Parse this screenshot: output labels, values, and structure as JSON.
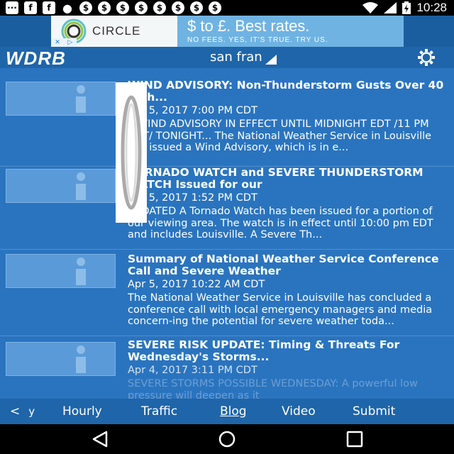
{
  "status_bar": {
    "time": "10:28",
    "icons": [
      "messages-icon",
      "facebook-icon",
      "facebook-icon",
      "location-pin-icon",
      "dollar-icon",
      "dollar-icon",
      "dollar-icon",
      "dollar-icon",
      "dollar-icon",
      "dollar-icon",
      "dollar-icon",
      "dollar-icon",
      "wifi-icon",
      "signal-icon",
      "battery-charging-icon"
    ]
  },
  "ad": {
    "brand": "CIRCLE",
    "headline": "$ to £. Best rates.",
    "subline": "NO FEES. YES, IT'S TRUE. TRY US.",
    "ad_choices_x": "✕",
    "ad_choices_arrow": "▷"
  },
  "app_bar": {
    "logo": "WDRB",
    "location": "san fran",
    "settings_icon": "gear-icon"
  },
  "articles": [
    {
      "title": "WIND ADVISORY: Non-Thunderstorm Gusts Over 40 mph...",
      "date": "Apr 5, 2017 7:00 PM CDT",
      "summary": "...WIND ADVISORY IN EFFECT UNTIL MIDNIGHT EDT /11 PM CDT/ TONIGHT... The National Weather Service in Louisville has issued a Wind Advisory, which is in e..."
    },
    {
      "title": "TORNADO WATCH and SEVERE THUNDERSTORM WATCH Issued for our",
      "date": "Apr 5, 2017 1:52 PM CDT",
      "summary": "UPDATED A Tornado Watch has been issued for a portion of our viewing area. The watch is in effect until 10:00 pm EDT and includes Louisville. A Severe Th..."
    },
    {
      "title": "Summary of National Weather Service Conference Call and Severe Weather",
      "date": "Apr 5, 2017 10:22 AM CDT",
      "summary": "The National Weather Service in Louisville has concluded a conference call with local emergency managers and media concern-ing the potential for severe weather toda..."
    },
    {
      "title": "SEVERE RISK UPDATE: Timing & Threats For Wednesday's Storms...",
      "date": "Apr 4, 2017 3:11 PM CDT",
      "summary": "SEVERE STORMS POSSIBLE WEDNESDAY: A powerful low pressure will deepen as it"
    }
  ],
  "tabs": {
    "back": "<",
    "partial": "y",
    "items": [
      "Hourly",
      "Traffic",
      "Blog",
      "Video",
      "Submit"
    ],
    "active": "Blog"
  },
  "nav": {
    "back": "back-triangle-icon",
    "home": "home-circle-icon",
    "recents": "recents-square-icon"
  },
  "colors": {
    "app_blue": "#1f65a9",
    "list_blue": "#2a74bf",
    "ad_blue": "#6fb3e3"
  }
}
